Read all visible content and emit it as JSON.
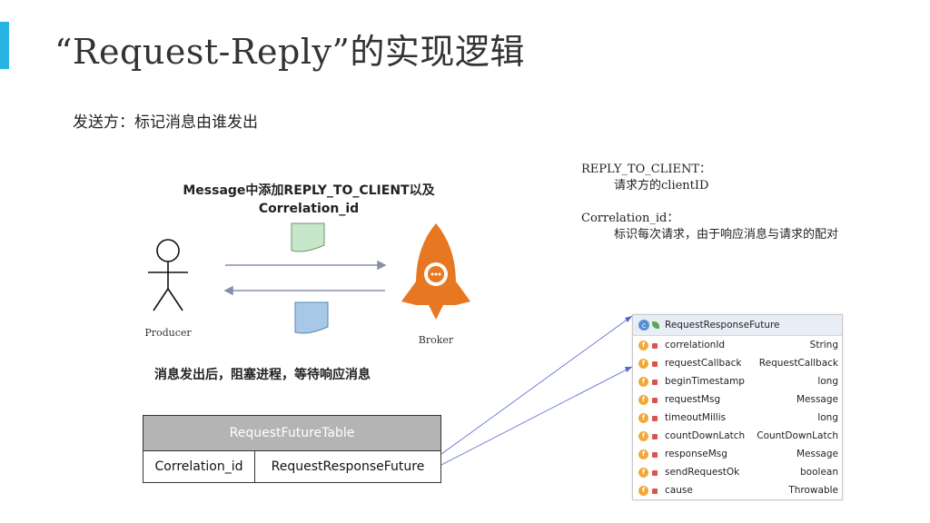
{
  "title": "“Request-Reply”的实现逻辑",
  "subtitle": "发送方：标记消息由谁发出",
  "diagram": {
    "message_label_line1": "Message中添加REPLY_TO_CLIENT以及",
    "message_label_line2": "Correlation_id",
    "producer_label": "Producer",
    "broker_label": "Broker",
    "blocking_label": "消息发出后，阻塞进程，等待响应消息",
    "colors": {
      "arrow": "#8a8fa8",
      "doc_green": "#c8e6c9",
      "doc_blue": "#a8c8e8",
      "rocket": "#e87722",
      "link_line": "#5566cc"
    }
  },
  "notes": {
    "reply_key": "REPLY_TO_CLIENT：",
    "reply_desc": "请求方的clientID",
    "corr_key": "Correlation_id：",
    "corr_desc": "标识每次请求，由于响应消息与请求的配对"
  },
  "table": {
    "header": "RequestFutureTable",
    "col1": "Correlation_id",
    "col2": "RequestResponseFuture"
  },
  "class_panel": {
    "class_name": "RequestResponseFuture",
    "fields": [
      {
        "name": "correlationId",
        "type": "String"
      },
      {
        "name": "requestCallback",
        "type": "RequestCallback"
      },
      {
        "name": "beginTimestamp",
        "type": "long"
      },
      {
        "name": "requestMsg",
        "type": "Message"
      },
      {
        "name": "timeoutMillis",
        "type": "long"
      },
      {
        "name": "countDownLatch",
        "type": "CountDownLatch"
      },
      {
        "name": "responseMsg",
        "type": "Message"
      },
      {
        "name": "sendRequestOk",
        "type": "boolean"
      },
      {
        "name": "cause",
        "type": "Throwable"
      }
    ]
  }
}
